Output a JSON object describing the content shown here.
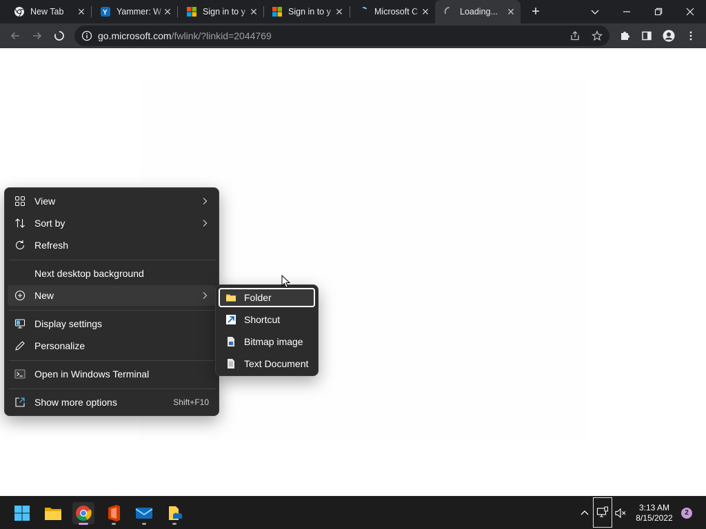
{
  "browser": {
    "tabs": [
      {
        "title": "New Tab",
        "favicon": "chrome-icon"
      },
      {
        "title": "Yammer: W",
        "favicon": "yammer-icon"
      },
      {
        "title": "Sign in to y",
        "favicon": "microsoft-icon"
      },
      {
        "title": "Sign in to y",
        "favicon": "microsoft-icon"
      },
      {
        "title": "Microsoft C",
        "favicon": "loading-spinner-icon"
      },
      {
        "title": "Loading...",
        "favicon": "loading-spinner-icon"
      }
    ],
    "active_tab_index": 5,
    "new_tab_label": "+",
    "url_host": "go.microsoft.com",
    "url_path": "/fwlink/?linkid=2044769",
    "accent_color": "#8ab4f8"
  },
  "context_menu": {
    "items": [
      {
        "label": "View",
        "icon": "grid-view-icon",
        "has_submenu": true
      },
      {
        "label": "Sort by",
        "icon": "sort-icon",
        "has_submenu": true
      },
      {
        "label": "Refresh",
        "icon": "refresh-icon",
        "has_submenu": false
      },
      {
        "label": "Next desktop background",
        "icon": "",
        "has_submenu": false
      },
      {
        "label": "New",
        "icon": "plus-circle-icon",
        "has_submenu": true
      },
      {
        "label": "Display settings",
        "icon": "display-settings-icon",
        "has_submenu": false
      },
      {
        "label": "Personalize",
        "icon": "pen-icon",
        "has_submenu": false
      },
      {
        "label": "Open in Windows Terminal",
        "icon": "terminal-icon",
        "has_submenu": false
      },
      {
        "label": "Show more options",
        "icon": "share-icon",
        "has_submenu": false,
        "shortcut": "Shift+F10"
      }
    ]
  },
  "new_submenu": {
    "items": [
      {
        "label": "Folder",
        "icon": "folder-icon",
        "selected": true
      },
      {
        "label": "Shortcut",
        "icon": "shortcut-arrow-icon",
        "selected": false
      },
      {
        "label": "Bitmap image",
        "icon": "bitmap-file-icon",
        "selected": false
      },
      {
        "label": "Text Document",
        "icon": "text-file-icon",
        "selected": false
      }
    ]
  },
  "taskbar": {
    "apps": [
      "windows-start-icon",
      "file-explorer-icon",
      "chrome-icon",
      "office-icon",
      "mail-icon",
      "onedrive-folder-icon"
    ],
    "time": "3:13 AM",
    "date": "8/15/2022",
    "notification_count": "2"
  }
}
